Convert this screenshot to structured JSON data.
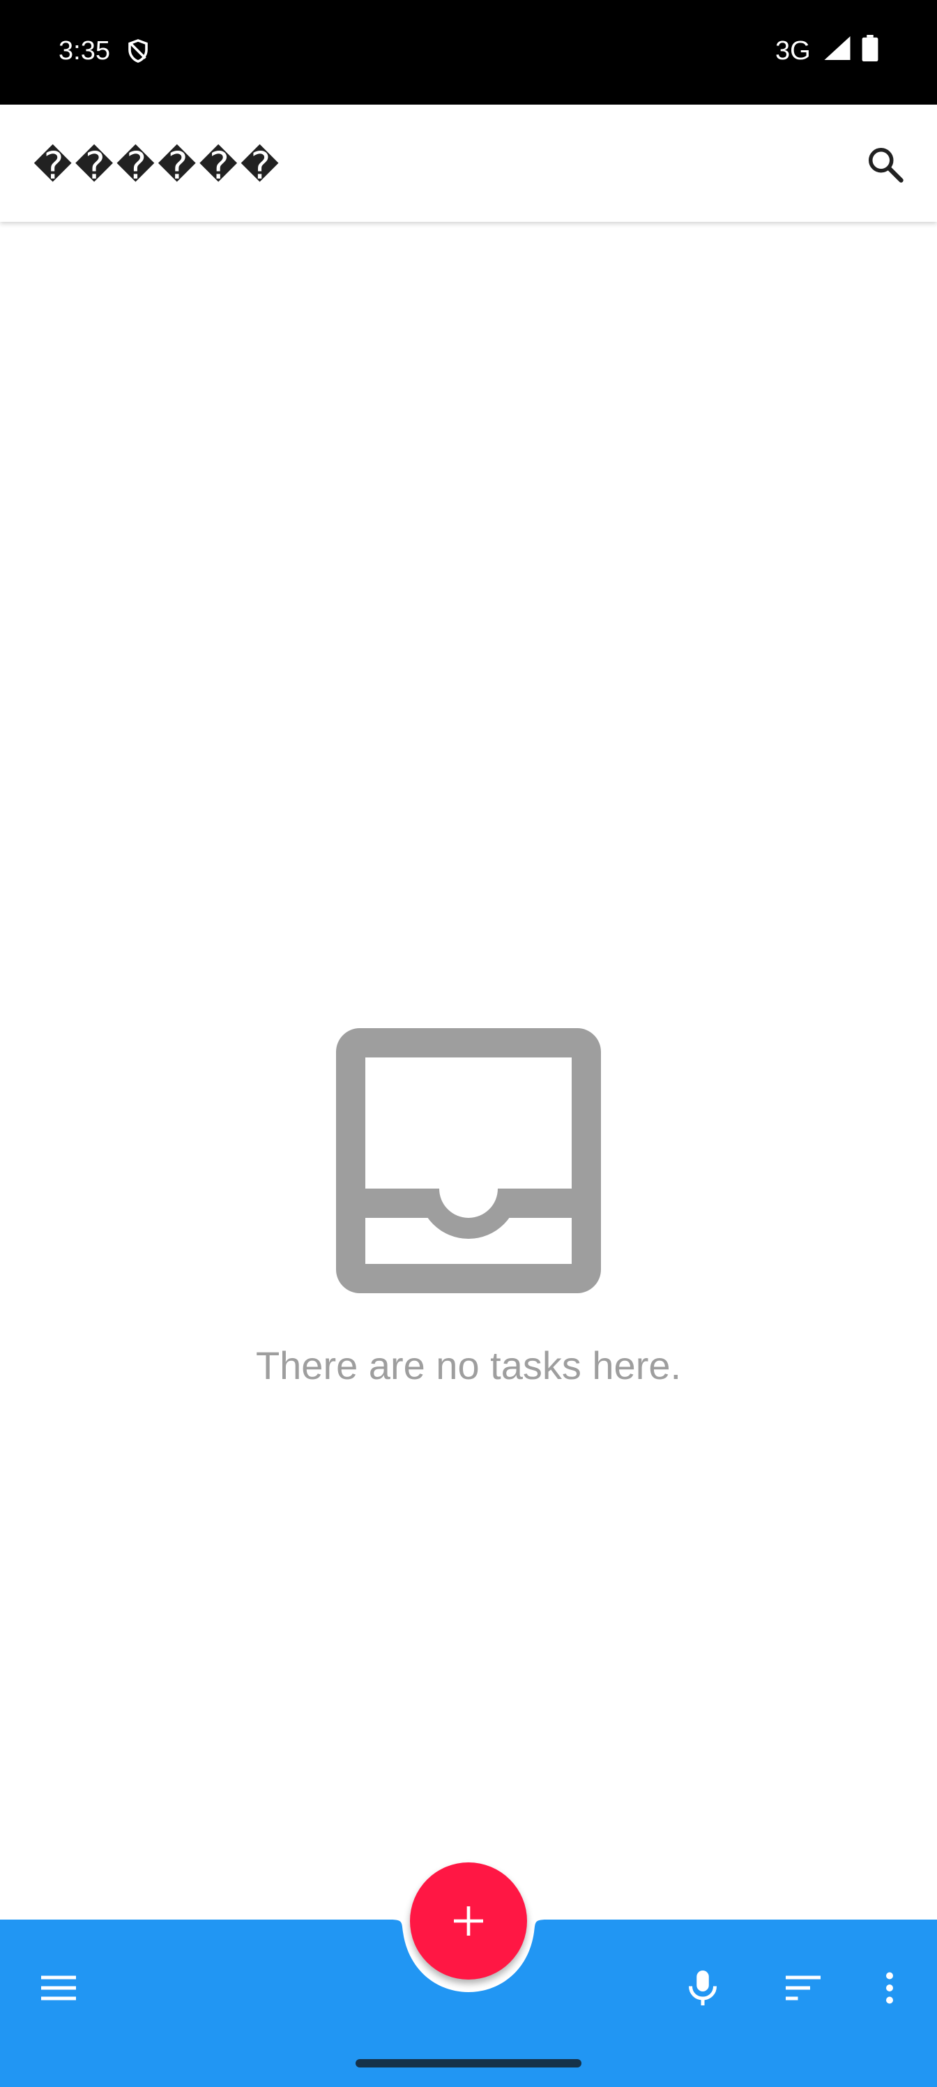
{
  "status_bar": {
    "time": "3:35",
    "network": "3G"
  },
  "app_bar": {
    "title": "������",
    "search_icon": "search-icon"
  },
  "empty_state": {
    "icon": "inbox-icon",
    "message": "There are no tasks here."
  },
  "bottom_bar": {
    "menu_icon": "menu-icon",
    "mic_icon": "mic-icon",
    "sort_icon": "sort-icon",
    "more_icon": "more-vert-icon"
  },
  "fab": {
    "icon": "add-icon"
  },
  "colors": {
    "status_bar": "#000000",
    "bottom_bar": "#2196f3",
    "fab": "#ff1744",
    "empty_icon": "#9e9e9e",
    "empty_text": "#9e9e9e"
  }
}
